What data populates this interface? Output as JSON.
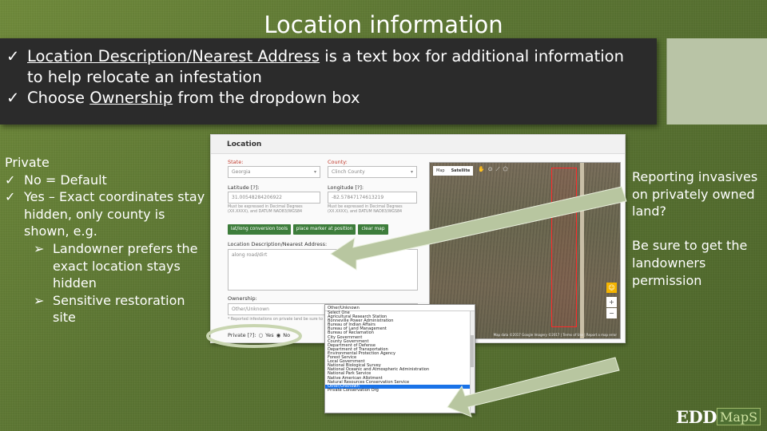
{
  "title": "Location information",
  "top_box": {
    "bullet1_prefix": "Location Description/Nearest Address",
    "bullet1_rest": " is a text box for additional information",
    "bullet1_line2": "to help relocate an infestation",
    "bullet2_a": "Choose ",
    "bullet2_u": "Ownership",
    "bullet2_b": " from the dropdown box"
  },
  "left_notes": {
    "heading": "Private",
    "item1": "No = Default",
    "item2": "Yes – Exact coordinates stay hidden, only county is shown, e.g.",
    "sub1": "Landowner prefers the exact location stays hidden",
    "sub2": "Sensitive restoration site"
  },
  "right_notes": {
    "p1": "Reporting invasives on privately owned land?",
    "p2": "Be sure to get the landowners permission"
  },
  "form": {
    "header": "Location",
    "state_label": "State:",
    "state_value": "Georgia",
    "county_label": "County:",
    "county_value": "Clinch County",
    "lat_label": "Latitude [?]:",
    "lat_value": "31.00548284206922",
    "lon_label": "Longitude [?]:",
    "lon_value": "-82.57847174613219",
    "lat_hint": "Must be expressed in Decimal Degrees (XX.XXXX), and DATUM NAD83/WGS84",
    "lon_hint": "Must be expressed in Decimal Degrees (XX.XXXX), and DATUM NAD83/WGS84",
    "btn1": "lat/long conversion tools",
    "btn2": "place marker at position",
    "btn3": "clear map",
    "desc_label": "Location Description/Nearest Address:",
    "desc_value": "along road/dirt",
    "ownership_label": "Ownership:",
    "ownership_value": "Other/Unknown",
    "footnote": "* Reported infestations on private land be sure to",
    "private_label": "Private [?]:",
    "private_yes": "Yes",
    "private_no": "No",
    "map_tab1": "Map",
    "map_tab2": "Satellite",
    "map_credit": "Map data ©2017 Google Imagery ©2017 | Terms of Use | Report a map error"
  },
  "dropdown": {
    "header": "Other/Unknown",
    "options": [
      "Select One",
      "Agricultural Research Station",
      "Bonneville Power Administration",
      "Bureau of Indian Affairs",
      "Bureau of Land Management",
      "Bureau of Reclamation",
      "City Government",
      "County Government",
      "Department of Defense",
      "Department of Transportation",
      "Environmental Protection Agency",
      "Forest Service",
      "Local Government",
      "National Biological Survey",
      "National Oceanic and Atmospheric Administration",
      "National Park Service",
      "Native American Allotment",
      "Natural Resources Conservation Service",
      "Other/Unknown",
      "Private Conservation Org"
    ],
    "selected_index": 18
  },
  "logo": {
    "edd": "EDD",
    "maps": "MapS"
  },
  "colors": {
    "background": "#56702f",
    "box": "#2b2b2b",
    "button": "#3d7d3b",
    "highlight": "#1a73e8",
    "marker": "#ff2a2a"
  }
}
